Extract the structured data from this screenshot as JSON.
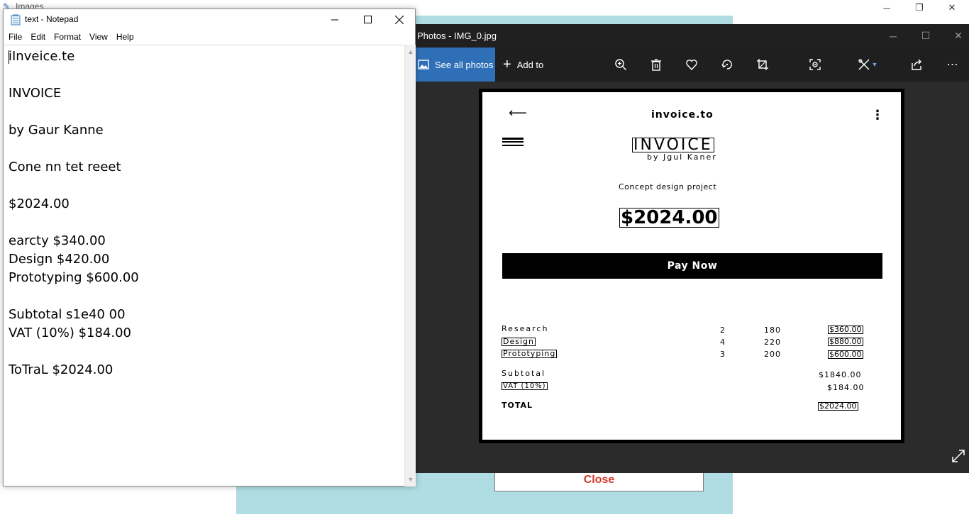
{
  "background_app": {
    "title": "Images",
    "close_button_label": "Close",
    "accent_color": "#b0dde3",
    "close_text_color": "#d23b2a"
  },
  "photos": {
    "title": "Photos - IMG_0.jpg",
    "see_all_label": "See all photos",
    "add_to_label": "Add to",
    "toolbar_icons": [
      "zoom-icon",
      "delete-icon",
      "favorite-icon",
      "rotate-icon",
      "crop-icon",
      "ocr-icon",
      "edit-icon",
      "share-icon",
      "more-icon"
    ],
    "invoice_image": {
      "header_title": "invoice.to",
      "heading": "INVOICE",
      "byline": "by Jgul Kaner",
      "project": "Concept design project",
      "amount": "$2024.00",
      "pay_now": "Pay Now",
      "items": [
        {
          "name": "Research",
          "qty": "2",
          "rate": "180",
          "amount": "$360.00"
        },
        {
          "name": "Design",
          "qty": "4",
          "rate": "220",
          "amount": "$880.00"
        },
        {
          "name": "Prototyping",
          "qty": "3",
          "rate": "200",
          "amount": "$600.00"
        }
      ],
      "subtotal_label": "Subtotal",
      "subtotal_value": "$1840.00",
      "vat_label": "VAT (10%)",
      "vat_value": "$184.00",
      "total_label": "TOTAL",
      "total_value": "$2024.00"
    }
  },
  "notepad": {
    "title": "text - Notepad",
    "menu": [
      "File",
      "Edit",
      "Format",
      "View",
      "Help"
    ],
    "content": "iInveice.te\n\nINVOICE\n\nby Gaur Kanne\n\nCone nn tet reeet\n\n$2024.00\n\nearcty $340.00\nDesign $420.00\nPrototyping $600.00\n\nSubtotal s1e40 00\nVAT (10%) $184.00\n\nToTraL $2024.00"
  }
}
